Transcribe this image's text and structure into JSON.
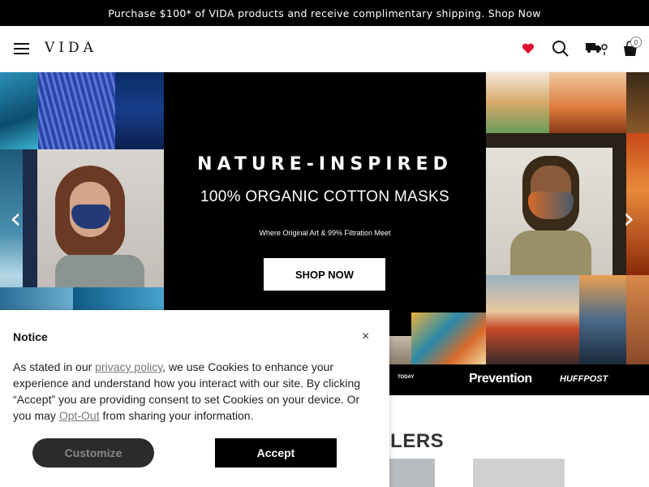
{
  "promo": {
    "text": "Purchase $100* of VIDA products and receive complimentary shipping. Shop Now"
  },
  "header": {
    "logo": "VIDA",
    "cart_count": "0"
  },
  "hero": {
    "headline": "NATURE-INSPIRED",
    "subheadline": "100% ORGANIC COTTON MASKS",
    "tagline": "Where Original Art & 99% Filtration Meet",
    "cta": "SHOP NOW",
    "prev_arrow": "‹",
    "next_arrow": "›"
  },
  "press": {
    "logos": [
      "TODAY",
      "Prevention",
      "HUFFPOST"
    ]
  },
  "bestsellers": {
    "title_fragment": "LLERS"
  },
  "notice": {
    "title": "Notice",
    "close": "×",
    "body_1": "As stated in our ",
    "privacy_link": "privacy policy",
    "body_2": ", we use Cookies to enhance your experience and understand how you interact with our site. By clicking “Accept” you are providing consent to set Cookies on your device. Or you may ",
    "optout_link": "Opt-Out",
    "body_3": " from sharing your information.",
    "customize": "Customize",
    "accept": "Accept"
  },
  "colors": {
    "black": "#000000",
    "heart_red": "#e0102e",
    "customize_bg": "#2b2b2b"
  }
}
